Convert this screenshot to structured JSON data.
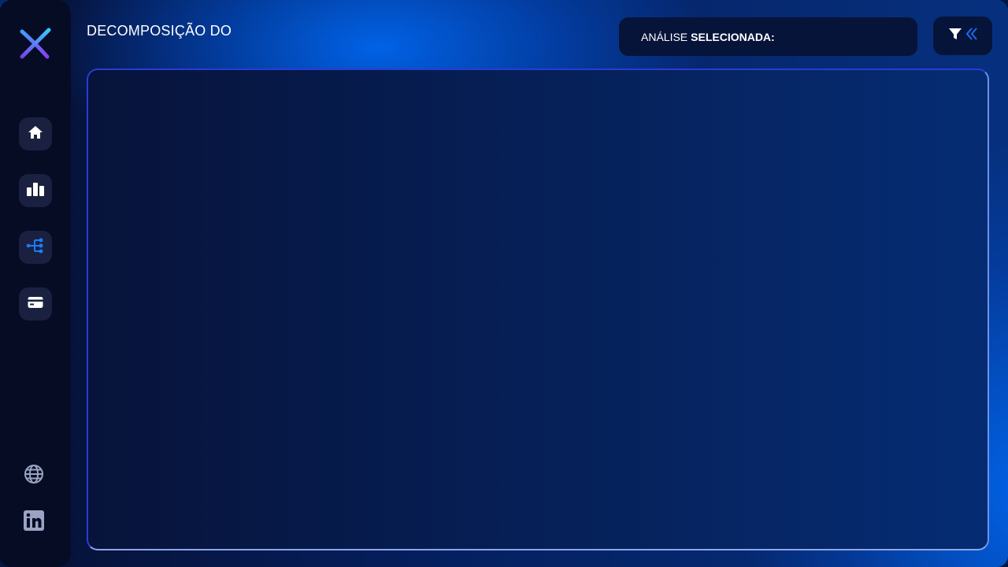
{
  "header": {
    "title": "DECOMPOSIÇÃO DO",
    "selection_label": "ANÁLISE",
    "selection_label_bold": "SELECIONADA:"
  },
  "sidebar": {
    "logo": "x-logo",
    "items": [
      {
        "icon": "home-icon",
        "active": false
      },
      {
        "icon": "bar-chart-icon",
        "active": false
      },
      {
        "icon": "decomposition-tree-icon",
        "active": true
      },
      {
        "icon": "card-icon",
        "active": false
      }
    ],
    "bottom_items": [
      {
        "icon": "globe-icon"
      },
      {
        "icon": "linkedin-icon"
      }
    ]
  },
  "toolbar": {
    "filter_icon": "filter-icon",
    "collapse_icon": "double-chevron-left-icon"
  },
  "colors": {
    "accent": "#1a6cf0",
    "sidebar_bg": "#060c24",
    "nav_button_bg": "#1a2140",
    "panel_border": "#2b3bd6"
  }
}
